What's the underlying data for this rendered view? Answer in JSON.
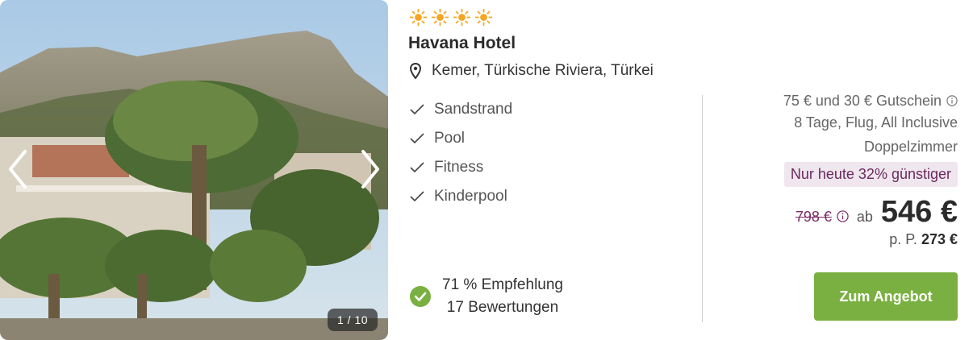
{
  "gallery": {
    "counter": "1 / 10",
    "prev_icon": "chevron-left-icon",
    "next_icon": "chevron-right-icon"
  },
  "hotel": {
    "stars": 4,
    "star_color": "#f5a623",
    "name": "Havana Hotel",
    "location_icon": "map-pin-icon",
    "location": "Kemer, Türkische Riviera, Türkei",
    "features": [
      "Sandstrand",
      "Pool",
      "Fitness",
      "Kinderpool"
    ],
    "recommendation": "71 % Empfehlung",
    "reviews": "17 Bewertungen",
    "recommendation_color": "#7ab041"
  },
  "offer": {
    "voucher": "75 € und 30 € Gutschein",
    "package": "8 Tage, Flug, All Inclusive",
    "room": "Doppelzimmer",
    "deal": "Nur heute 32% günstiger",
    "old_price": "798 €",
    "from_label": "ab",
    "price": "546 €",
    "per_person_label": "p. P.",
    "per_person_price": "273 €",
    "cta_label": "Zum Angebot",
    "cta_color": "#7ab041",
    "deal_color": "#6b2a5e"
  }
}
